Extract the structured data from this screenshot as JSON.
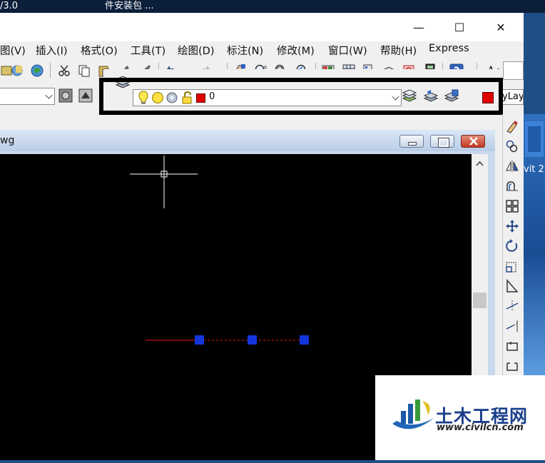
{
  "desktop": {
    "topleft_text": "/3.0",
    "topmid_text": "件安装包 ...",
    "right_text": "vit 2"
  },
  "window": {
    "controls": {
      "minimize": "—",
      "maximize": "☐",
      "close": "✕"
    },
    "menu": [
      "图(V)",
      "插入(I)",
      "格式(O)",
      "工具(T)",
      "绘图(D)",
      "标注(N)",
      "修改(M)",
      "窗口(W)",
      "帮助(H)",
      "Express"
    ],
    "layer_toolbar": {
      "current_layer": "0",
      "bylayer_text": "yLay"
    },
    "colors": {
      "highlight_border": "#000000",
      "canvas": "#000000",
      "layer_swatch": "#e00000",
      "grip": "#1434dc",
      "line": "#c01010"
    }
  },
  "drawing": {
    "title": "wg"
  },
  "logo": {
    "name": "土木工程网",
    "url": "www.civilcn.com"
  }
}
